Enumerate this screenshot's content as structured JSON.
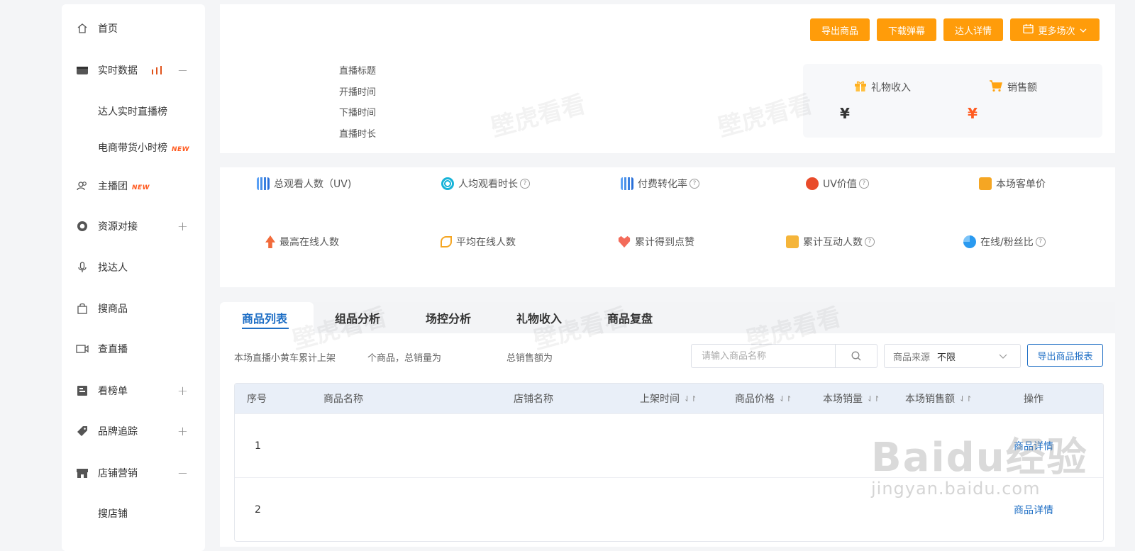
{
  "sidebar": {
    "items": [
      {
        "label": "首页",
        "icon": "home-icon"
      },
      {
        "label": "实时数据",
        "icon": "live-icon",
        "toggle": "−"
      },
      {
        "label": "达人实时直播榜"
      },
      {
        "label": "电商带货小时榜",
        "badge": "NEW"
      },
      {
        "label": "主播团",
        "icon": "group-icon",
        "badge": "NEW"
      },
      {
        "label": "资源对接",
        "icon": "resource-icon",
        "toggle": "+"
      },
      {
        "label": "找达人",
        "icon": "mic-icon"
      },
      {
        "label": "搜商品",
        "icon": "bag-icon"
      },
      {
        "label": "查直播",
        "icon": "video-icon"
      },
      {
        "label": "看榜单",
        "icon": "chart-board-icon",
        "toggle": "+"
      },
      {
        "label": "品牌追踪",
        "icon": "tag-icon",
        "toggle": "+"
      },
      {
        "label": "店铺营销",
        "icon": "store-icon",
        "toggle": "−"
      },
      {
        "label": "搜店铺"
      }
    ]
  },
  "header": {
    "buttons": {
      "export_products": "导出商品",
      "download_danmu": "下载弹幕",
      "influencer_detail": "达人详情",
      "more_sessions": "更多场次"
    },
    "info_labels": {
      "title": "直播标题",
      "start": "开播时间",
      "end": "下播时间",
      "duration": "直播时长"
    },
    "gift_income": {
      "label": "礼物收入",
      "value": "¥"
    },
    "sales": {
      "label": "销售额",
      "value": "¥"
    }
  },
  "metrics": {
    "uv": "总观看人数（UV)",
    "avg_watch": "人均观看时长",
    "pay_rate": "付费转化率",
    "uv_value": "UV价值",
    "unit_price": "本场客单价",
    "peak_online": "最高在线人数",
    "avg_online": "平均在线人数",
    "likes": "累计得到点赞",
    "interact": "累计互动人数",
    "fan_ratio": "在线/粉丝比"
  },
  "tabs": [
    "商品列表",
    "组品分析",
    "场控分析",
    "礼物收入",
    "商品复盘"
  ],
  "summary": {
    "part1": "本场直播小黄车累计上架",
    "part2": "个商品，总销量为",
    "part3": "总销售额为"
  },
  "search": {
    "placeholder": "请输入商品名称"
  },
  "source_filter": {
    "label": "商品来源",
    "value": "不限"
  },
  "export_report": "导出商品报表",
  "table": {
    "headers": {
      "index": "序号",
      "name": "商品名称",
      "shop": "店铺名称",
      "listed": "上架时间",
      "price": "商品价格",
      "sales": "本场销量",
      "revenue": "本场销售额",
      "action": "操作"
    },
    "rows": [
      {
        "index": "1",
        "action": "商品详情"
      },
      {
        "index": "2",
        "action": "商品详情"
      }
    ]
  },
  "watermarks": {
    "brand": "壁虎看看",
    "baidu": "Baidu经验",
    "baidu_url": "jingyan.baidu.com"
  },
  "colors": {
    "accent": "#ff9c0a",
    "link": "#1f6fc5",
    "price": "#ff5a1f"
  }
}
